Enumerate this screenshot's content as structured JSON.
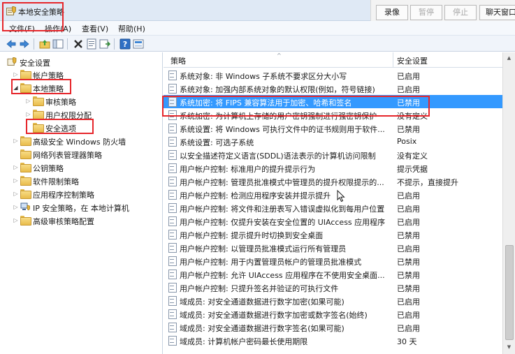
{
  "window": {
    "title": "本地安全策略",
    "icon": "security-policy-icon"
  },
  "recorder": {
    "record": "录像",
    "pause": "暂停",
    "stop": "停止",
    "chat": "聊天窗口"
  },
  "menu": [
    {
      "label": "文件(F)"
    },
    {
      "label": "操作(A)"
    },
    {
      "label": "查看(V)"
    },
    {
      "label": "帮助(H)"
    }
  ],
  "toolbar": [
    "back-arrow-icon",
    "forward-arrow-icon",
    "up-folder-icon",
    "show-tree-icon",
    "delete-icon",
    "properties-icon",
    "export-list-icon",
    "help-icon",
    "view-icon"
  ],
  "tree": {
    "root": "安全设置",
    "items": [
      {
        "label": "帐户策略",
        "expander": "▷"
      },
      {
        "label": "本地策略",
        "expander": "◢"
      },
      {
        "label": "审核策略",
        "expander": "▷"
      },
      {
        "label": "用户权限分配",
        "expander": "▷"
      },
      {
        "label": "安全选项",
        "expander": ""
      },
      {
        "label": "高级安全 Windows 防火墙",
        "expander": "▷"
      },
      {
        "label": "网络列表管理器策略",
        "expander": ""
      },
      {
        "label": "公钥策略",
        "expander": "▷"
      },
      {
        "label": "软件限制策略",
        "expander": "▷"
      },
      {
        "label": "应用程序控制策略",
        "expander": "▷"
      },
      {
        "label": "IP 安全策略，在 本地计算机",
        "expander": "▷"
      },
      {
        "label": "高级审核策略配置",
        "expander": "▷"
      }
    ]
  },
  "list": {
    "headers": {
      "policy": "策略",
      "setting": "安全设置"
    },
    "rows": [
      {
        "policy": "系统对象: 非 Windows 子系统不要求区分大小写",
        "setting": "已启用"
      },
      {
        "policy": "系统对象: 加强内部系统对象的默认权限(例如，符号链接)",
        "setting": "已启用"
      },
      {
        "policy": "系统加密: 将 FIPS 兼容算法用于加密、哈希和签名",
        "setting": "已禁用"
      },
      {
        "policy": "系统加密: 为计算机上存储的用户密钥强制进行强密钥保护",
        "setting": "没有定义"
      },
      {
        "policy": "系统设置: 将 Windows 可执行文件中的证书规则用于软件...",
        "setting": "已禁用"
      },
      {
        "policy": "系统设置: 可选子系统",
        "setting": "Posix"
      },
      {
        "policy": "以安全描述符定义语言(SDDL)语法表示的计算机访问限制",
        "setting": "没有定义"
      },
      {
        "policy": "用户帐户控制: 标准用户的提升提示行为",
        "setting": "提示凭据"
      },
      {
        "policy": "用户帐户控制: 管理员批准模式中管理员的提升权限提示的...",
        "setting": "不提示，直接提升"
      },
      {
        "policy": "用户帐户控制: 检测应用程序安装并提示提升",
        "setting": "已启用"
      },
      {
        "policy": "用户帐户控制: 将文件和注册表写入错误虚拟化到每用户位置",
        "setting": "已启用"
      },
      {
        "policy": "用户帐户控制: 仅提升安装在安全位置的 UIAccess 应用程序",
        "setting": "已启用"
      },
      {
        "policy": "用户帐户控制: 提示提升时切换到安全桌面",
        "setting": "已禁用"
      },
      {
        "policy": "用户帐户控制: 以管理员批准模式运行所有管理员",
        "setting": "已启用"
      },
      {
        "policy": "用户帐户控制: 用于内置管理员帐户的管理员批准模式",
        "setting": "已禁用"
      },
      {
        "policy": "用户帐户控制: 允许 UIAccess 应用程序在不使用安全桌面...",
        "setting": "已禁用"
      },
      {
        "policy": "用户帐户控制: 只提升签名并验证的可执行文件",
        "setting": "已禁用"
      },
      {
        "policy": "域成员: 对安全通道数据进行数字加密(如果可能)",
        "setting": "已启用"
      },
      {
        "policy": "域成员: 对安全通道数据进行数字加密或数字签名(始终)",
        "setting": "已启用"
      },
      {
        "policy": "域成员: 对安全通道数据进行数字签名(如果可能)",
        "setting": "已启用"
      },
      {
        "policy": "域成员: 计算机帐户密码最长使用期限",
        "setting": "30 天"
      }
    ]
  },
  "colors": {
    "selection": "#3399ff",
    "highlight": "#e6262b",
    "folder": "#e9bc4c"
  }
}
